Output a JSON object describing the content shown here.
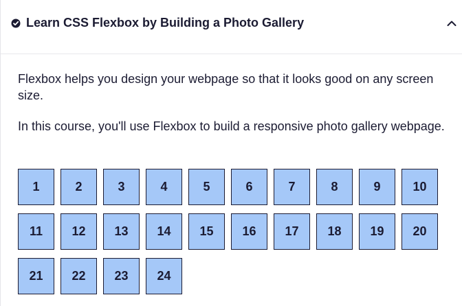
{
  "section": {
    "title": "Learn CSS Flexbox by Building a Photo Gallery",
    "status_icon": "check-circle-icon",
    "toggle_icon": "chevron-up-icon"
  },
  "description": {
    "paragraph_1": "Flexbox helps you design your webpage so that it looks good on any screen size.",
    "paragraph_2": "In this course, you'll use Flexbox to build a responsive photo gallery webpage."
  },
  "gallery": {
    "tiles": [
      "1",
      "2",
      "3",
      "4",
      "5",
      "6",
      "7",
      "8",
      "9",
      "10",
      "11",
      "12",
      "13",
      "14",
      "15",
      "16",
      "17",
      "18",
      "19",
      "20",
      "21",
      "22",
      "23",
      "24"
    ]
  },
  "colors": {
    "tile_fill": "#a5c8f8",
    "tile_border": "#1b1b32",
    "text": "#1b1b32"
  }
}
